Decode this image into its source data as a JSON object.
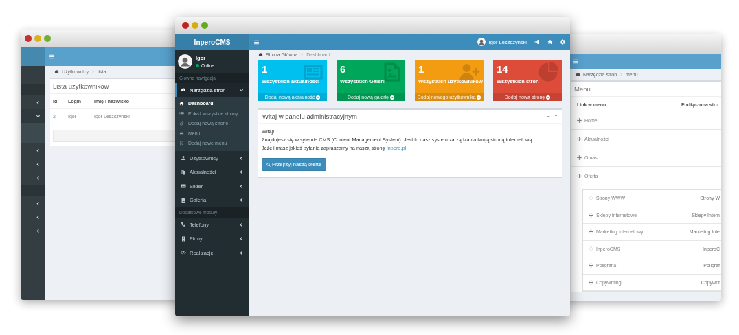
{
  "left_window": {
    "sidebar_groups": [
      {
        "rows": [
          {
            "expanded": false
          },
          {
            "expanded": true
          },
          {
            "expanded": false
          },
          {
            "expanded": false
          },
          {
            "expanded": false
          }
        ]
      },
      {
        "rows": [
          {
            "expanded": false
          },
          {
            "expanded": false
          },
          {
            "expanded": false
          }
        ]
      }
    ],
    "breadcrumb": [
      "Użytkownicy",
      "lista"
    ],
    "card": {
      "title": "Lista użytkowników",
      "columns": [
        "Id",
        "Login",
        "Imię i nazwisko"
      ],
      "rows": [
        [
          "2",
          "Igor",
          "Igor Leszczyński"
        ]
      ]
    }
  },
  "main_window": {
    "brand": "InperoCMS",
    "user": {
      "name": "Igor",
      "status": "Online"
    },
    "nav_groups": [
      {
        "heading": "Główna nawigacja",
        "items": [
          {
            "label": "Narzędzia stron",
            "expanded": true,
            "children": [
              {
                "label": "Dashboard",
                "selected": true
              },
              {
                "label": "Pokaż wszystkie strony",
                "selected": false
              },
              {
                "label": "Dodaj nową stronę",
                "selected": false
              },
              {
                "label": "Menu",
                "selected": false
              },
              {
                "label": "Dodaj nowe menu",
                "selected": false
              }
            ]
          },
          {
            "label": "Użytkownicy",
            "expanded": false
          },
          {
            "label": "Aktualności",
            "expanded": false
          },
          {
            "label": "Slider",
            "expanded": false
          },
          {
            "label": "Galeria",
            "expanded": false
          }
        ]
      },
      {
        "heading": "Dodatkowe moduły",
        "items": [
          {
            "label": "Telefony",
            "expanded": false
          },
          {
            "label": "Firmy",
            "expanded": false
          },
          {
            "label": "Realizacje",
            "expanded": false
          }
        ]
      }
    ],
    "topbar": {
      "user_name": "Igor Leszczyński"
    },
    "breadcrumb": [
      "Strona Główna",
      "Dashboard"
    ],
    "stat_cards": [
      {
        "count": "1",
        "label": "Wszystkich aktualności",
        "link": "Dodaj nową aktualność",
        "color": "#00c0ef"
      },
      {
        "count": "6",
        "label": "Wszystkich Galerii",
        "link": "Dodaj nową galerię",
        "color": "#00a65a"
      },
      {
        "count": "1",
        "label": "Wszystkich użytkowników",
        "link": "Dodaj nowego użytkownika",
        "color": "#f39c12"
      },
      {
        "count": "14",
        "label": "Wszystkich stron",
        "link": "Dodaj nową stronę",
        "color": "#dd4b39"
      }
    ],
    "welcome_panel": {
      "title": "Witaj w panelu administracyjnym",
      "greeting": "Witaj!",
      "line": "Znajdujesz się w sytemie CMS (Content Management System). Jest to nasz system zarządzania twoją stroną internetową.",
      "question": "Jeżeli masz jakieś pytania zapraszamy na naszą stronę",
      "link": "Inpero.pl",
      "button": "Przejrzyj naszą oferte"
    }
  },
  "right_window": {
    "breadcrumb": [
      "Narzędzia stron",
      "menu"
    ],
    "card_title": "Menu",
    "columns": [
      "Link w menu",
      "Podłączona stro"
    ],
    "rows": [
      {
        "label": "Home"
      },
      {
        "label": "Aktualności"
      },
      {
        "label": "O nas"
      },
      {
        "label": "Oferta",
        "children": [
          {
            "label": "Strony WWW",
            "page": "Strony W"
          },
          {
            "label": "Sklepy internetowe",
            "page": "Sklepy Intern"
          },
          {
            "label": "Marketing internetowy",
            "page": "Marketing Inte"
          },
          {
            "label": "InperoCMS",
            "page": "InperoC"
          },
          {
            "label": "Poligrafia",
            "page": "Poligraf"
          },
          {
            "label": "Copywriting",
            "page": "Copywrit"
          }
        ]
      }
    ]
  }
}
